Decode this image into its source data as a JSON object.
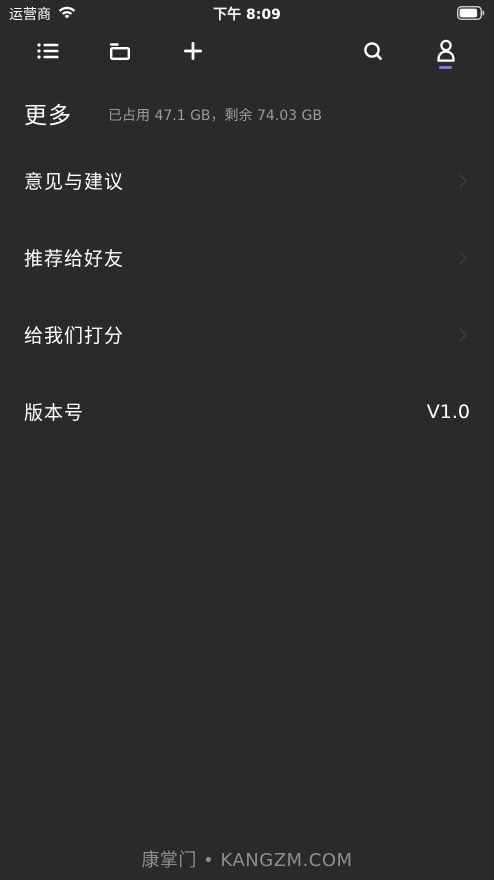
{
  "status_bar": {
    "carrier": "运营商",
    "time": "下午 8:09"
  },
  "toolbar": {
    "icons": [
      "list-icon",
      "folder-icon",
      "plus-icon",
      "search-icon",
      "person-icon"
    ],
    "active_indicator_color": "#8a6cf2"
  },
  "header": {
    "title": "更多",
    "storage": "已占用 47.1 GB，剩余 74.03 GB"
  },
  "menu": {
    "items": [
      {
        "label": "意见与建议"
      },
      {
        "label": "推荐给好友"
      },
      {
        "label": "给我们打分"
      },
      {
        "label": "版本号",
        "value": "V1.0"
      }
    ]
  },
  "watermark": "康掌门 • KANGZM.COM",
  "colors": {
    "background": "#2a2a2b",
    "text": "#ffffff",
    "secondary_text": "#9a9a9c",
    "accent": "#8a6cf2"
  }
}
